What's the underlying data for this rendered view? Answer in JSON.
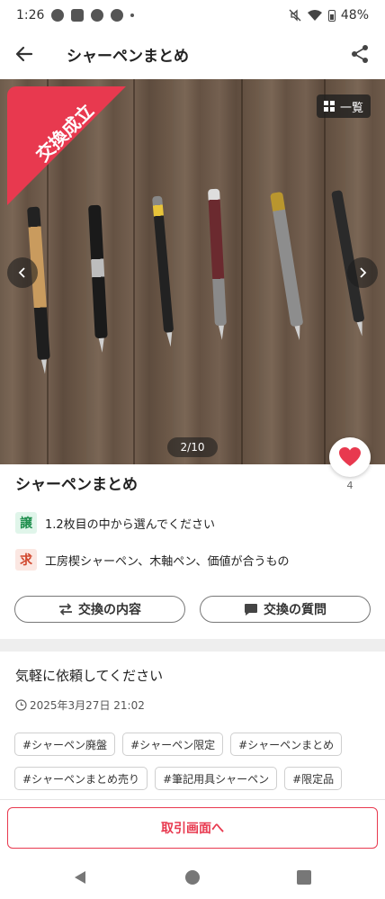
{
  "status_bar": {
    "time": "1:26",
    "battery": "48%"
  },
  "header": {
    "title": "シャーペンまとめ"
  },
  "photo": {
    "sold_label": "交換成立",
    "list_label": "一覧",
    "pager": "2/10"
  },
  "like": {
    "count": "4"
  },
  "item": {
    "title": "シャーペンまとめ",
    "give_badge": "譲",
    "give_text": "1.2枚目の中から選んでください",
    "want_badge": "求",
    "want_text": "工房楔シャーペン、木軸ペン、価値が合うもの"
  },
  "actions": {
    "content_label": "交換の内容",
    "question_label": "交換の質問"
  },
  "description": {
    "text": "気軽に依頼してください",
    "date": "2025年3月27日 21:02"
  },
  "tags": [
    "#シャーペン廃盤",
    "#シャーペン限定",
    "#シャーペンまとめ",
    "#シャーペンまとめ売り",
    "#筆記用具シャーペン",
    "#限定品"
  ],
  "bottom": {
    "trade_screen_label": "取引画面へ"
  },
  "colors": {
    "accent": "#e8394f",
    "give": "#1f8f4e",
    "want": "#d0452b"
  },
  "icons": [
    "back-arrow-icon",
    "share-icon",
    "grid-icon",
    "chevron-left-icon",
    "chevron-right-icon",
    "heart-icon",
    "swap-icon",
    "chat-bubble-icon",
    "clock-icon"
  ]
}
